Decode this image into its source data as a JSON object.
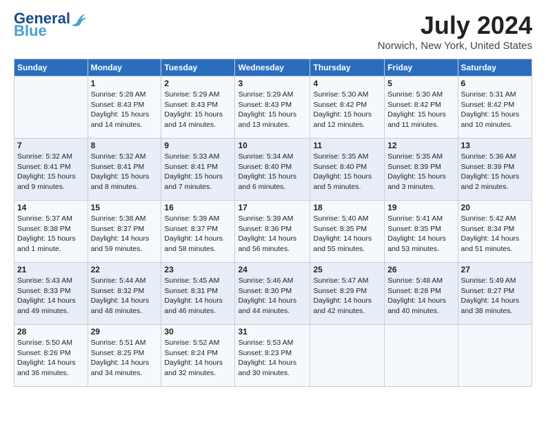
{
  "logo": {
    "line1": "General",
    "line2": "Blue"
  },
  "title": "July 2024",
  "subtitle": "Norwich, New York, United States",
  "days_of_week": [
    "Sunday",
    "Monday",
    "Tuesday",
    "Wednesday",
    "Thursday",
    "Friday",
    "Saturday"
  ],
  "weeks": [
    [
      {
        "day": "",
        "info": ""
      },
      {
        "day": "1",
        "info": "Sunrise: 5:28 AM\nSunset: 8:43 PM\nDaylight: 15 hours\nand 14 minutes."
      },
      {
        "day": "2",
        "info": "Sunrise: 5:29 AM\nSunset: 8:43 PM\nDaylight: 15 hours\nand 14 minutes."
      },
      {
        "day": "3",
        "info": "Sunrise: 5:29 AM\nSunset: 8:43 PM\nDaylight: 15 hours\nand 13 minutes."
      },
      {
        "day": "4",
        "info": "Sunrise: 5:30 AM\nSunset: 8:42 PM\nDaylight: 15 hours\nand 12 minutes."
      },
      {
        "day": "5",
        "info": "Sunrise: 5:30 AM\nSunset: 8:42 PM\nDaylight: 15 hours\nand 11 minutes."
      },
      {
        "day": "6",
        "info": "Sunrise: 5:31 AM\nSunset: 8:42 PM\nDaylight: 15 hours\nand 10 minutes."
      }
    ],
    [
      {
        "day": "7",
        "info": "Sunrise: 5:32 AM\nSunset: 8:41 PM\nDaylight: 15 hours\nand 9 minutes."
      },
      {
        "day": "8",
        "info": "Sunrise: 5:32 AM\nSunset: 8:41 PM\nDaylight: 15 hours\nand 8 minutes."
      },
      {
        "day": "9",
        "info": "Sunrise: 5:33 AM\nSunset: 8:41 PM\nDaylight: 15 hours\nand 7 minutes."
      },
      {
        "day": "10",
        "info": "Sunrise: 5:34 AM\nSunset: 8:40 PM\nDaylight: 15 hours\nand 6 minutes."
      },
      {
        "day": "11",
        "info": "Sunrise: 5:35 AM\nSunset: 8:40 PM\nDaylight: 15 hours\nand 5 minutes."
      },
      {
        "day": "12",
        "info": "Sunrise: 5:35 AM\nSunset: 8:39 PM\nDaylight: 15 hours\nand 3 minutes."
      },
      {
        "day": "13",
        "info": "Sunrise: 5:36 AM\nSunset: 8:39 PM\nDaylight: 15 hours\nand 2 minutes."
      }
    ],
    [
      {
        "day": "14",
        "info": "Sunrise: 5:37 AM\nSunset: 8:38 PM\nDaylight: 15 hours\nand 1 minute."
      },
      {
        "day": "15",
        "info": "Sunrise: 5:38 AM\nSunset: 8:37 PM\nDaylight: 14 hours\nand 59 minutes."
      },
      {
        "day": "16",
        "info": "Sunrise: 5:39 AM\nSunset: 8:37 PM\nDaylight: 14 hours\nand 58 minutes."
      },
      {
        "day": "17",
        "info": "Sunrise: 5:39 AM\nSunset: 8:36 PM\nDaylight: 14 hours\nand 56 minutes."
      },
      {
        "day": "18",
        "info": "Sunrise: 5:40 AM\nSunset: 8:35 PM\nDaylight: 14 hours\nand 55 minutes."
      },
      {
        "day": "19",
        "info": "Sunrise: 5:41 AM\nSunset: 8:35 PM\nDaylight: 14 hours\nand 53 minutes."
      },
      {
        "day": "20",
        "info": "Sunrise: 5:42 AM\nSunset: 8:34 PM\nDaylight: 14 hours\nand 51 minutes."
      }
    ],
    [
      {
        "day": "21",
        "info": "Sunrise: 5:43 AM\nSunset: 8:33 PM\nDaylight: 14 hours\nand 49 minutes."
      },
      {
        "day": "22",
        "info": "Sunrise: 5:44 AM\nSunset: 8:32 PM\nDaylight: 14 hours\nand 48 minutes."
      },
      {
        "day": "23",
        "info": "Sunrise: 5:45 AM\nSunset: 8:31 PM\nDaylight: 14 hours\nand 46 minutes."
      },
      {
        "day": "24",
        "info": "Sunrise: 5:46 AM\nSunset: 8:30 PM\nDaylight: 14 hours\nand 44 minutes."
      },
      {
        "day": "25",
        "info": "Sunrise: 5:47 AM\nSunset: 8:29 PM\nDaylight: 14 hours\nand 42 minutes."
      },
      {
        "day": "26",
        "info": "Sunrise: 5:48 AM\nSunset: 8:28 PM\nDaylight: 14 hours\nand 40 minutes."
      },
      {
        "day": "27",
        "info": "Sunrise: 5:49 AM\nSunset: 8:27 PM\nDaylight: 14 hours\nand 38 minutes."
      }
    ],
    [
      {
        "day": "28",
        "info": "Sunrise: 5:50 AM\nSunset: 8:26 PM\nDaylight: 14 hours\nand 36 minutes."
      },
      {
        "day": "29",
        "info": "Sunrise: 5:51 AM\nSunset: 8:25 PM\nDaylight: 14 hours\nand 34 minutes."
      },
      {
        "day": "30",
        "info": "Sunrise: 5:52 AM\nSunset: 8:24 PM\nDaylight: 14 hours\nand 32 minutes."
      },
      {
        "day": "31",
        "info": "Sunrise: 5:53 AM\nSunset: 8:23 PM\nDaylight: 14 hours\nand 30 minutes."
      },
      {
        "day": "",
        "info": ""
      },
      {
        "day": "",
        "info": ""
      },
      {
        "day": "",
        "info": ""
      }
    ]
  ]
}
